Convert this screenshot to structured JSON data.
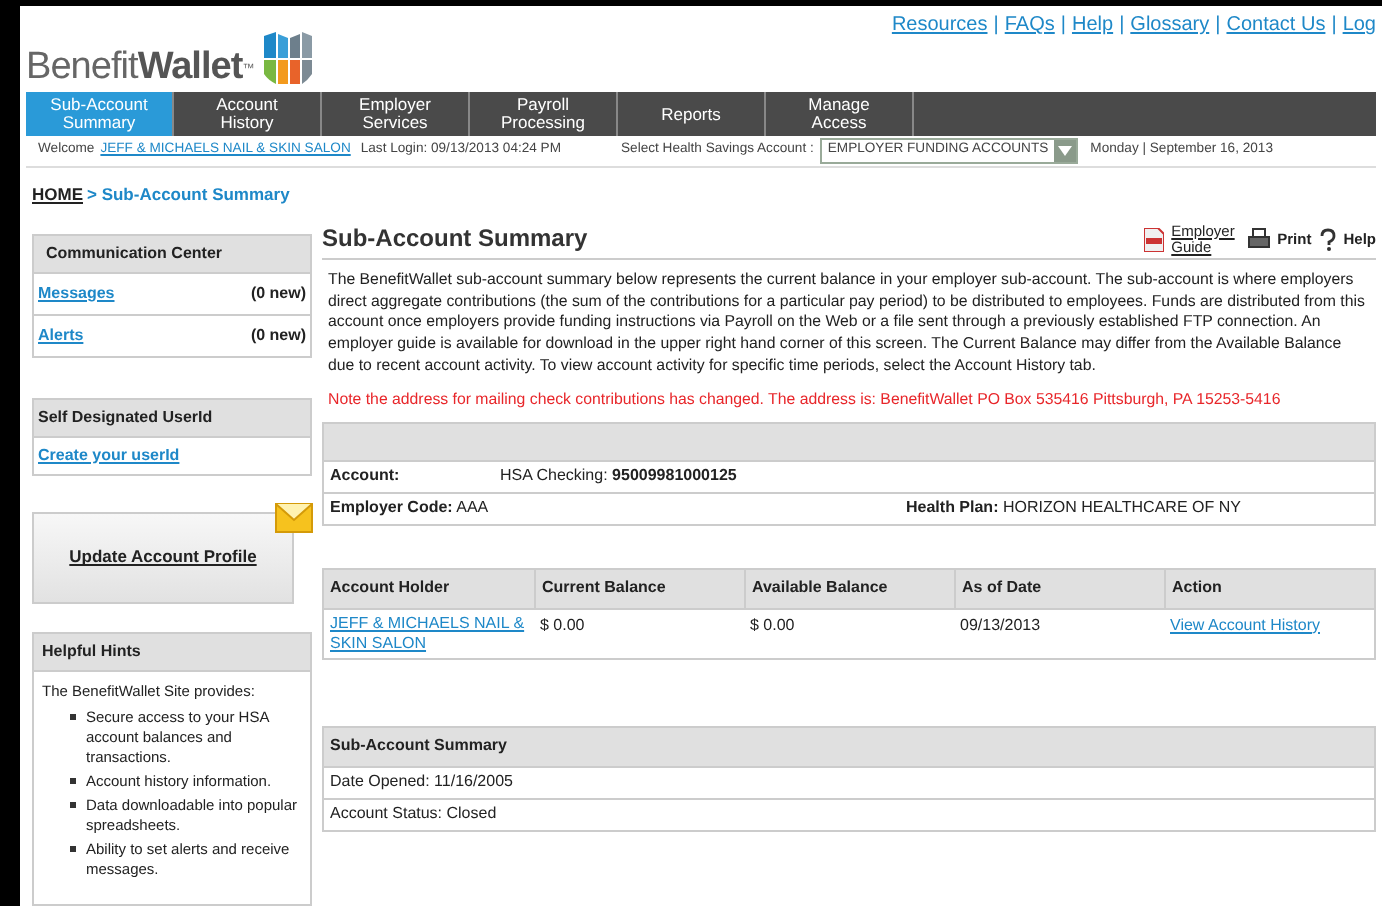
{
  "logo": {
    "text_regular": "Benefit",
    "text_bold": "Wallet",
    "tm": "™"
  },
  "top_links": [
    "Resources",
    "FAQs",
    "Help",
    "Glossary",
    "Contact Us",
    "Log"
  ],
  "link_separator": "|",
  "tabs": [
    {
      "label": "Sub-Account Summary",
      "selected": true
    },
    {
      "label": "Account History",
      "selected": false
    },
    {
      "label": "Employer Services",
      "selected": false
    },
    {
      "label": "Payroll Processing",
      "selected": false
    },
    {
      "label": "Reports",
      "selected": false
    },
    {
      "label": "Manage Access",
      "selected": false
    }
  ],
  "welcome": {
    "label": "Welcome",
    "name": "JEFF & MICHAELS NAIL & SKIN SALON",
    "last_login": "Last Login: 09/13/2013 04:24 PM",
    "select_label": "Select Health Savings Account :",
    "select_value": "EMPLOYER FUNDING ACCOUNTS",
    "date": "Monday | September 16, 2013"
  },
  "breadcrumb": {
    "home": "HOME",
    "current": "> Sub-Account Summary"
  },
  "sidebar": {
    "communication": {
      "title": "Communication Center",
      "items": [
        {
          "label": "Messages",
          "count": "(0 new)"
        },
        {
          "label": "Alerts",
          "count": "(0 new)"
        }
      ]
    },
    "userid": {
      "title": "Self Designated UserId",
      "link": "Create your userId"
    },
    "profile_button": "Update Account Profile",
    "hints": {
      "title": "Helpful Hints",
      "intro": "The BenefitWallet Site provides:",
      "items": [
        "Secure access to your HSA account balances and transactions.",
        "Account history information.",
        "Data downloadable into popular spreadsheets.",
        "Ability to set alerts and receive messages."
      ]
    }
  },
  "main": {
    "title": "Sub-Account Summary",
    "tools": {
      "guide": "Employer Guide",
      "print": "Print",
      "help": "Help"
    },
    "description": "The BenefitWallet sub-account summary below represents the current balance in your employer sub-account. The sub-account is where employers direct aggregate contributions (the sum of the contributions for a particular pay period) to be distributed to employees. Funds are distributed from this account once employers provide funding instructions via Payroll on the Web or a file sent through a previously established FTP connection. An employer guide is available for download in the upper right hand corner of this screen. The Current Balance may differ from the Available Balance due to recent account activity. To view account activity for specific time periods, select the Account History tab.",
    "notice": "Note the address for mailing check contributions has changed. The address is: BenefitWallet PO Box 535416 Pittsburgh, PA 15253-5416",
    "account_info": {
      "account_label": "Account:",
      "account_type": "HSA Checking:",
      "account_number": "95009981000125",
      "employer_code_label": "Employer Code:",
      "employer_code": "AAA",
      "health_plan_label": "Health Plan:",
      "health_plan": "HORIZON HEALTHCARE OF NY"
    },
    "table": {
      "columns": [
        "Account Holder",
        "Current Balance",
        "Available Balance",
        "As of Date",
        "Action"
      ],
      "rows": [
        {
          "holder": "JEFF & MICHAELS NAIL & SKIN SALON",
          "current": "$ 0.00",
          "available": "$ 0.00",
          "date": "09/13/2013",
          "action": "View Account History"
        }
      ]
    },
    "summary": {
      "title": "Sub-Account Summary",
      "lines": [
        "Date Opened: 11/16/2005",
        "Account Status: Closed"
      ]
    }
  }
}
